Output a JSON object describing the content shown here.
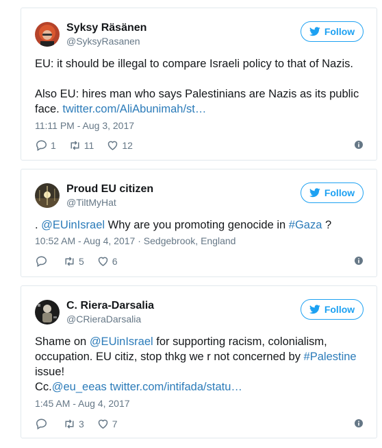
{
  "follow_label": "Follow",
  "tweets": [
    {
      "name": "Syksy Räsänen",
      "handle": "@SyksyRasanen",
      "line1": "EU: it should be illegal to compare Israeli policy to that of Nazis.",
      "line2": "Also EU: hires man who says Palestinians are Nazis as its public face.",
      "link": "twitter.com/AliAbunimah/st…",
      "timestamp": "11:11 PM - Aug 3, 2017",
      "replies": "1",
      "retweets": "11",
      "likes": "12"
    },
    {
      "name": "Proud EU citizen",
      "handle": "@TiltMyHat",
      "pre": ". ",
      "mention": "@EUinIsrael",
      "mid": " Why are you promoting genocide in ",
      "hashtag": "#Gaza",
      "post": " ?",
      "timestamp": "10:52 AM - Aug 4, 2017",
      "location": " · Sedgebrook, England",
      "replies": "",
      "retweets": "5",
      "likes": "6"
    },
    {
      "name": "C. Riera-Darsalia",
      "handle": "@CRieraDarsalia",
      "pre": "Shame on ",
      "mention": "@EUinIsrael",
      "mid": " for supporting racism, colonialism, occupation. EU citiz, stop thkg we r not concerned by ",
      "hashtag": "#Palestine",
      "post": " issue!",
      "cc": "Cc.",
      "mention2": "@eu_eeas",
      "link": " twitter.com/intifada/statu…",
      "timestamp": "1:45 AM - Aug 4, 2017",
      "replies": "",
      "retweets": "3",
      "likes": "7"
    }
  ]
}
